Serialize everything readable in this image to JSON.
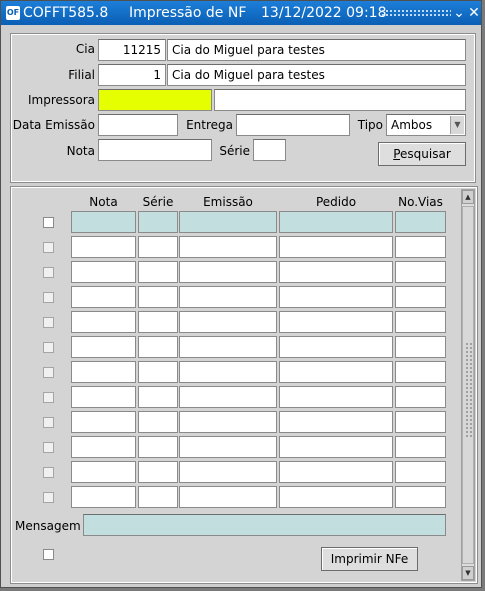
{
  "titlebar": {
    "form_code": "COFFT585.8",
    "title": "Impressão de NF",
    "datetime": "13/12/2022 09:18",
    "minimize_glyph": "⌄",
    "close_glyph": "✕"
  },
  "header": {
    "cia_label": "Cia",
    "cia_code": "11215",
    "cia_name": "Cia do Miguel para testes",
    "filial_label": "Filial",
    "filial_code": "1",
    "filial_name": "Cia do Miguel para testes",
    "impressora_label": "Impressora",
    "impressora_value": "",
    "impressora_desc": "",
    "data_emissao_label": "Data Emissão",
    "data_emissao_value": "",
    "entrega_label": "Entrega",
    "entrega_value": "",
    "tipo_label": "Tipo",
    "tipo_value": "Ambos",
    "nota_label": "Nota",
    "nota_value": "",
    "serie_label": "Série",
    "serie_value": "",
    "pesquisar_first": "P",
    "pesquisar_rest": "esquisar"
  },
  "grid": {
    "columns": [
      "Nota",
      "Série",
      "Emissão",
      "Pedido",
      "No.Vias"
    ],
    "row_count": 12
  },
  "footer": {
    "mensagem_label": "Mensagem",
    "mensagem_value": "",
    "imprimir_label": "Imprimir NFe"
  },
  "colors": {
    "titlebar": "#0a5fb4",
    "required_field": "#e6ff00",
    "current_row": "#c2dede"
  }
}
